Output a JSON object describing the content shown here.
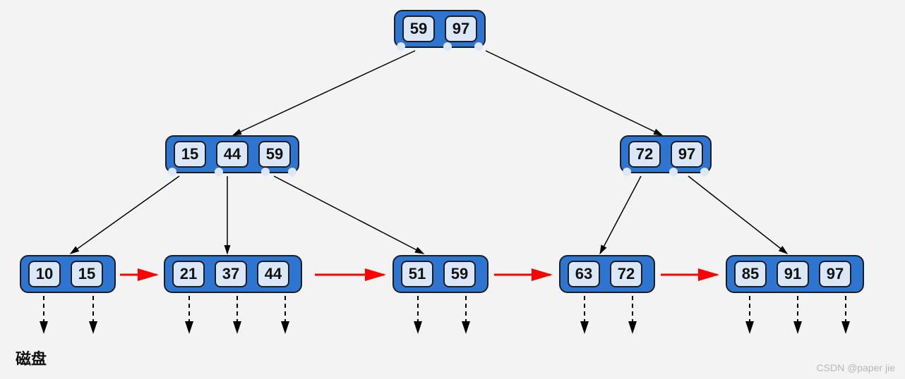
{
  "diagram_type": "B+ tree",
  "colors": {
    "node_fill": "#2e75d1",
    "key_fill": "#dbe7f6",
    "border": "#1d1d1d",
    "leaf_link": "#ff0000",
    "background": "#f3f3f3"
  },
  "labels": {
    "disk": "磁盘",
    "watermark": "CSDN @paper jie"
  },
  "levels": {
    "root": {
      "keys": [
        "59",
        "97"
      ]
    },
    "internal": [
      {
        "id": "L",
        "keys": [
          "15",
          "44",
          "59"
        ]
      },
      {
        "id": "R",
        "keys": [
          "72",
          "97"
        ]
      }
    ],
    "leaves": [
      {
        "id": "leaf1",
        "keys": [
          "10",
          "15"
        ]
      },
      {
        "id": "leaf2",
        "keys": [
          "21",
          "37",
          "44"
        ]
      },
      {
        "id": "leaf3",
        "keys": [
          "51",
          "59"
        ]
      },
      {
        "id": "leaf4",
        "keys": [
          "63",
          "72"
        ]
      },
      {
        "id": "leaf5",
        "keys": [
          "85",
          "91",
          "97"
        ]
      }
    ]
  },
  "tree_edges": [
    [
      "root",
      "L"
    ],
    [
      "root",
      "R"
    ],
    [
      "L",
      "leaf1"
    ],
    [
      "L",
      "leaf2"
    ],
    [
      "L",
      "leaf3"
    ],
    [
      "R",
      "leaf4"
    ],
    [
      "R",
      "leaf5"
    ]
  ],
  "leaf_links": [
    [
      "leaf1",
      "leaf2"
    ],
    [
      "leaf2",
      "leaf3"
    ],
    [
      "leaf3",
      "leaf4"
    ],
    [
      "leaf4",
      "leaf5"
    ]
  ]
}
